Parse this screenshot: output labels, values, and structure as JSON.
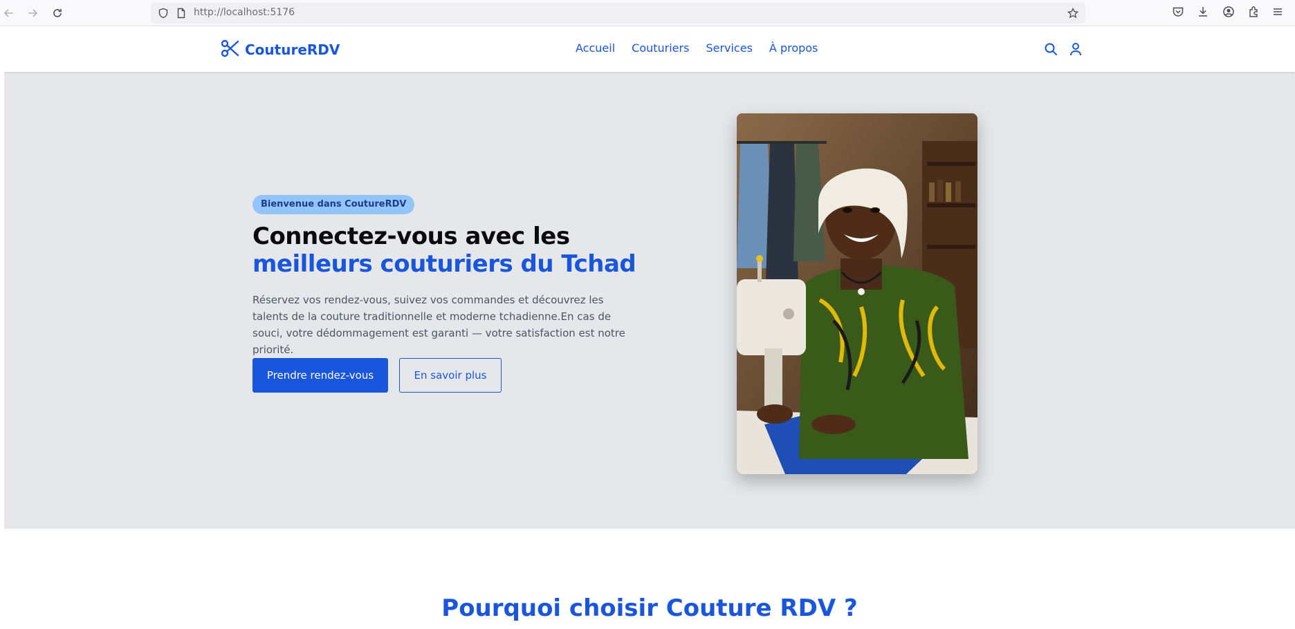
{
  "browser": {
    "url": "http://localhost:5176",
    "icons": [
      "back-icon",
      "forward-icon",
      "reload-icon",
      "shield-icon",
      "page-icon",
      "bookmark-star-icon",
      "pocket-icon",
      "download-icon",
      "account-icon",
      "extensions-icon",
      "menu-icon"
    ]
  },
  "header": {
    "logo_text": "CoutureRDV",
    "nav": [
      {
        "label": "Accueil"
      },
      {
        "label": "Couturiers"
      },
      {
        "label": "Services"
      },
      {
        "label": "À propos"
      }
    ]
  },
  "hero": {
    "badge": "Bienvenue dans CoutureRDV",
    "title_line1": "Connectez-vous avec les",
    "title_line2": "meilleurs couturiers du Tchad",
    "description": "Réservez vos rendez-vous, suivez vos commandes et découvrez les talents de la couture traditionnelle et moderne tchadienne.En cas de souci, votre dédommagement est garanti — votre satisfaction est notre priorité.",
    "primary_button": "Prendre rendez-vous",
    "secondary_button": "En savoir plus"
  },
  "features": {
    "title": "Pourquoi choisir Couture RDV ?"
  },
  "colors": {
    "brand": "#1a56db",
    "hero_bg": "#e5e7eb",
    "badge_bg": "#93c5fd"
  }
}
